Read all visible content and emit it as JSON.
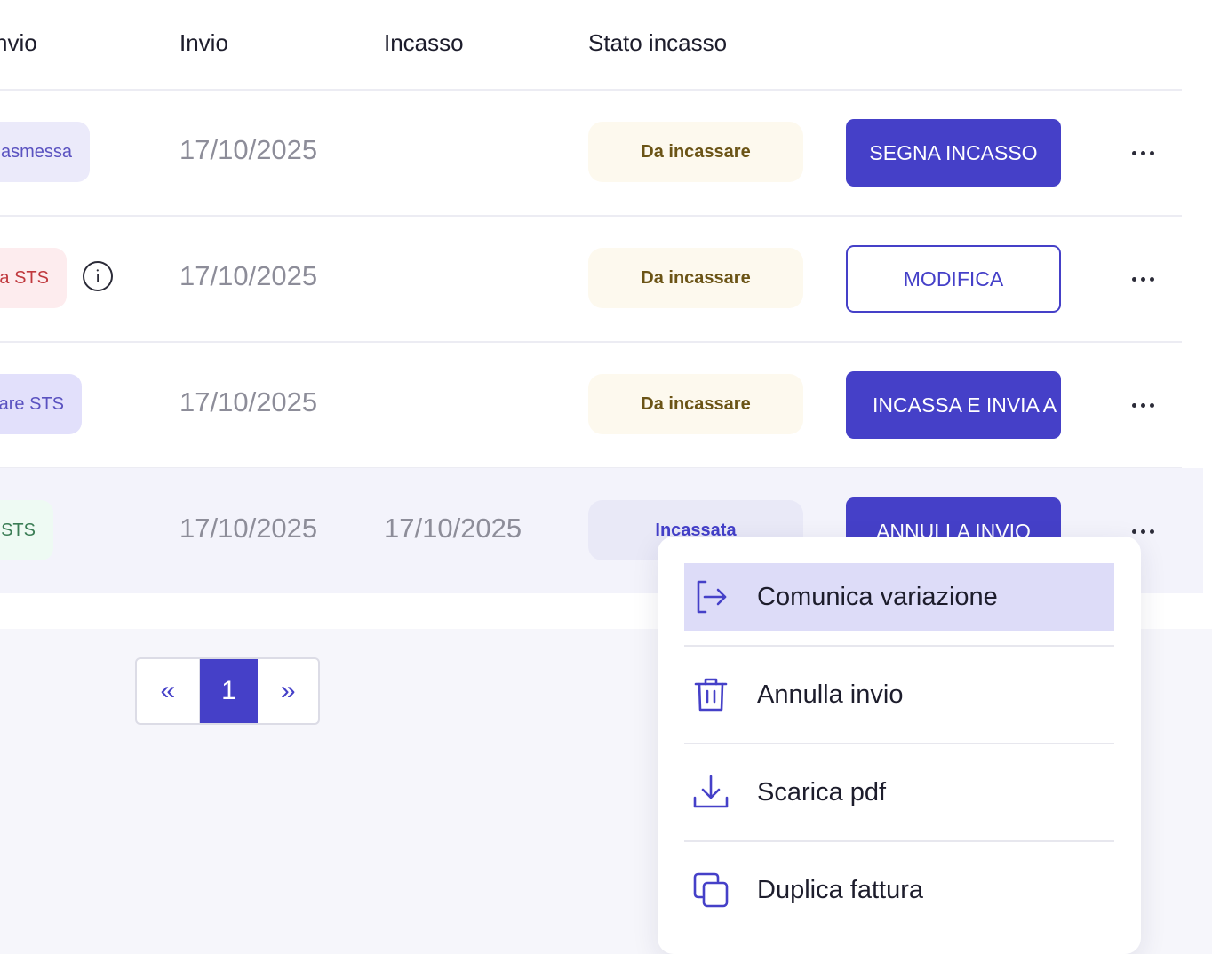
{
  "columns": {
    "prev_invio": "nvio",
    "invio": "Invio",
    "incasso": "Incasso",
    "stato_incasso": "Stato incasso"
  },
  "rows": [
    {
      "status_fragment": "asmessa",
      "invio_date": "17/10/2025",
      "incasso_date": "",
      "stato": "Da incassare",
      "action": "SEGNA INCASSO"
    },
    {
      "status_fragment": "ta STS",
      "invio_date": "17/10/2025",
      "incasso_date": "",
      "stato": "Da incassare",
      "action": "MODIFICA",
      "info_glyph": "i"
    },
    {
      "status_fragment": "are STS",
      "invio_date": "17/10/2025",
      "incasso_date": "",
      "stato": "Da incassare",
      "action": "INCASSA E INVIA A"
    },
    {
      "status_fragment": "STS",
      "invio_date": "17/10/2025",
      "incasso_date": "17/10/2025",
      "stato": "Incassata",
      "action": "ANNULLA INVIO"
    }
  ],
  "pagination": {
    "prev": "«",
    "current": "1",
    "next": "»"
  },
  "dropdown": {
    "items": [
      {
        "label": "Comunica variazione",
        "icon": "exit-arrow-icon",
        "active": true
      },
      {
        "label": "Annulla invio",
        "icon": "trash-icon"
      },
      {
        "label": "Scarica pdf",
        "icon": "download-icon"
      },
      {
        "label": "Duplica fattura",
        "icon": "duplicate-icon"
      }
    ]
  },
  "colors": {
    "accent": "#4540c8",
    "due_bg": "#fdf9ee",
    "due_text": "#6b5416",
    "paid_bg": "#e9e9f7",
    "menu_active_bg": "#dddcf8",
    "pill_sent_bg": "#ebeafa",
    "pill_error_bg": "#fdecee",
    "pill_pending_bg": "#e2e0fb",
    "pill_ok_bg": "#eefaf3"
  }
}
